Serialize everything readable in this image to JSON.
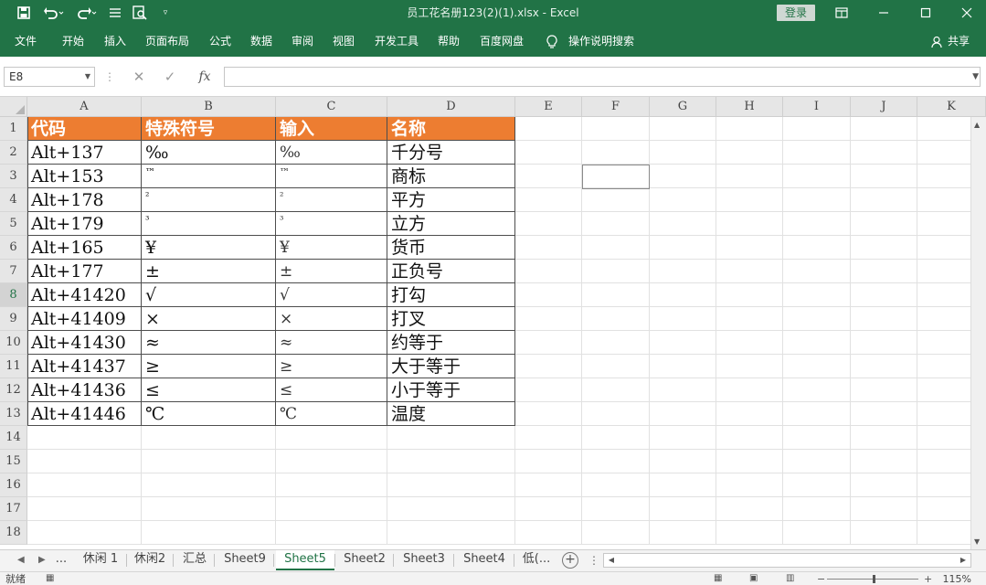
{
  "titlebar": {
    "title": "员工花名册123(2)(1).xlsx  -  Excel",
    "login_label": "登录",
    "icons": {
      "save": "save-icon",
      "undo": "undo-icon",
      "redo": "redo-icon",
      "form": "form-icon",
      "print_preview": "print-preview-icon",
      "customize": "chevron-down-icon",
      "ribbon_options": "ribbon-display-icon",
      "minimize": "minimize-icon",
      "maximize": "maximize-icon",
      "close": "close-icon"
    }
  },
  "ribbon": {
    "tabs": [
      "文件",
      "开始",
      "插入",
      "页面布局",
      "公式",
      "数据",
      "审阅",
      "视图",
      "开发工具",
      "帮助",
      "百度网盘"
    ],
    "tell_me": "操作说明搜索",
    "share": "共享"
  },
  "formula_bar": {
    "name_box": "E8",
    "fx_label": "fx",
    "value": ""
  },
  "grid": {
    "columns": [
      "A",
      "B",
      "C",
      "D",
      "E",
      "F",
      "G",
      "H",
      "I",
      "J",
      "K"
    ],
    "rows": [
      "1",
      "2",
      "3",
      "4",
      "5",
      "6",
      "7",
      "8",
      "9",
      "10",
      "11",
      "12",
      "13",
      "14",
      "15",
      "16",
      "17",
      "18"
    ],
    "header": [
      "代码",
      "特殊符号",
      "输入",
      "名称"
    ],
    "data": [
      [
        "Alt+137",
        "‰",
        "‰",
        "千分号"
      ],
      [
        "Alt+153",
        "™",
        "™",
        "商标"
      ],
      [
        "Alt+178",
        "²",
        "²",
        "平方"
      ],
      [
        "Alt+179",
        "³",
        "³",
        "立方"
      ],
      [
        "Alt+165",
        "¥",
        "¥",
        "货币"
      ],
      [
        "Alt+177",
        "±",
        "±",
        "正负号"
      ],
      [
        "Alt+41420",
        "√",
        "√",
        "打勾"
      ],
      [
        "Alt+41409",
        "×",
        "×",
        "打叉"
      ],
      [
        "Alt+41430",
        "≈",
        "≈",
        "约等于"
      ],
      [
        "Alt+41437",
        "≥",
        "≥",
        "大于等于"
      ],
      [
        "Alt+41436",
        "≤",
        "≤",
        "小于等于"
      ],
      [
        "Alt+41446",
        "℃",
        "℃",
        "温度"
      ]
    ],
    "header_color": "#ED7D31"
  },
  "sheets": {
    "tabs": [
      "...",
      "休闲 1",
      "休闲2",
      "汇总",
      "Sheet9",
      "Sheet5",
      "Sheet2",
      "Sheet3",
      "Sheet4",
      "低(..."
    ],
    "active": "Sheet5"
  },
  "status": {
    "ready": "就绪",
    "zoom": "115%",
    "zoom_minus": "−",
    "zoom_plus": "+"
  },
  "colors": {
    "brand": "#217346",
    "header_fill": "#ED7D31"
  }
}
